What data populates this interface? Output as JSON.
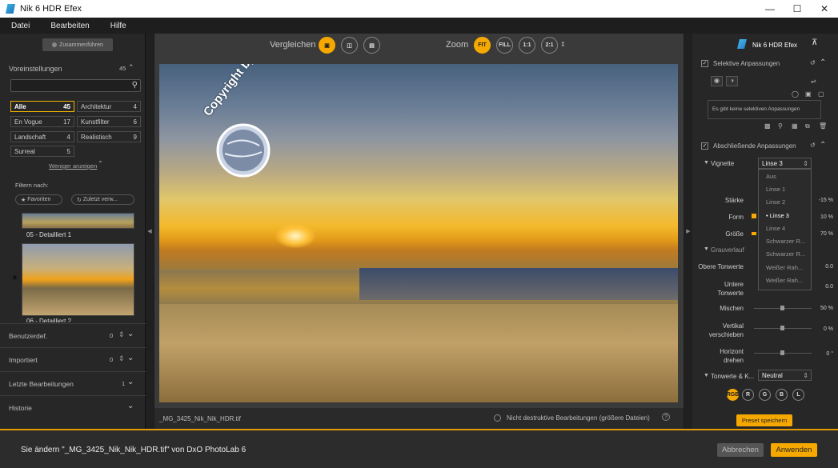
{
  "window": {
    "title": "Nik 6 HDR Efex",
    "min_label": "—",
    "max_label": "☐",
    "close_label": "✕"
  },
  "menu": {
    "file": "Datei",
    "edit": "Bearbeiten",
    "help": "Hilfe"
  },
  "left": {
    "merge_button": "Zusammenführen",
    "presets_title": "Voreinstellungen",
    "presets_count": "45",
    "categories": [
      {
        "name": "Alle",
        "count": "45"
      },
      {
        "name": "Architektur",
        "count": "4"
      },
      {
        "name": "En Vogue",
        "count": "17"
      },
      {
        "name": "Kunstfilter",
        "count": "6"
      },
      {
        "name": "Landschaft",
        "count": "4"
      },
      {
        "name": "Realistisch",
        "count": "9"
      },
      {
        "name": "Surreal",
        "count": "5"
      }
    ],
    "show_less": "Weniger anzeigen",
    "filter_by": "Filtern nach:",
    "favorites": "Favoriten",
    "recent": "Zuletzt verw...",
    "thumb1_label": "05 - Detailliert 1",
    "thumb2_label": "06 - Detailliert 2",
    "sections": [
      {
        "label": "Benutzerdef.",
        "count": "0"
      },
      {
        "label": "Importiert",
        "count": "0"
      },
      {
        "label": "Letzte Bearbeitungen",
        "count": "1"
      },
      {
        "label": "Historie",
        "count": ""
      }
    ]
  },
  "center": {
    "compare_label": "Vergleichen",
    "zoom_label": "Zoom",
    "zoom_buttons": [
      "FIT",
      "FILL",
      "1:1",
      "2:1"
    ],
    "filename": "_MG_3425_Nik_Nik_HDR.tif",
    "nondestructive": "Nicht destruktive Bearbeitungen (größere Dateien)",
    "help": "?",
    "watermark_text": "Copyright by Ahadesign.eu"
  },
  "right": {
    "title": "Nik 6 HDR Efex",
    "selective_title": "Selektive Anpassungen",
    "no_selective": "Es gibt keine selektiven Anpassungen",
    "final_title": "Abschließende Anpassungen",
    "vignette_label": "Vignette",
    "vignette_value": "Linse 3",
    "vignette_options": [
      "Aus",
      "Linse 1",
      "Linse 2",
      "Linse 3",
      "Linse 4",
      "Schwarzer R...",
      "Schwarzer R...",
      "Weißer Rah...",
      "Weißer Rah..."
    ],
    "rows": [
      {
        "label": "Stärke",
        "value": "-15 %"
      },
      {
        "label": "Form",
        "value": "10 %"
      },
      {
        "label": "Größe",
        "value": "70 %"
      }
    ],
    "gradient_label": "Grauverlauf",
    "upper_label": "Obere Tonwerte",
    "upper_value": "0.0",
    "lower_label": "Untere Tonwerte",
    "lower_value": "0.0",
    "mix_label": "Mischen",
    "mix_value": "50 %",
    "vshift_label": "Vertikal verschieben",
    "vshift_value": "0 %",
    "rotate_label": "Horizont drehen",
    "rotate_value": "0 °",
    "tone_label": "Tonwerte & K...",
    "tone_value": "Neutral",
    "channels": [
      "RGB",
      "R",
      "G",
      "B",
      "L"
    ],
    "save_preset": "Preset speichern"
  },
  "footer": {
    "message": "Sie ändern \"_MG_3425_Nik_Nik_HDR.tif\" von DxO PhotoLab 6",
    "cancel": "Abbrechen",
    "apply": "Anwenden"
  },
  "colors": {
    "accent": "#f5a800"
  }
}
